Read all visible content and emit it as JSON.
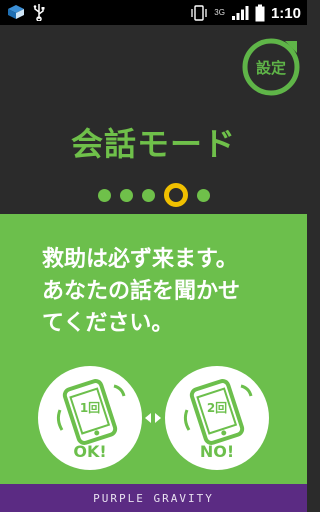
{
  "status_bar": {
    "time": "1:10",
    "network": "3G",
    "icons": [
      "dropbox-icon",
      "usb-icon",
      "vibrate-icon",
      "network-3g-icon",
      "signal-icon",
      "battery-icon"
    ]
  },
  "settings": {
    "label": "設定"
  },
  "title": "会話モード",
  "pager": {
    "count": 5,
    "active_index": 3
  },
  "message": "救助は必ず来ます。\nあなたの話を聞かせ\nてください。",
  "buttons": {
    "ok": {
      "count": "1回",
      "label": "OK!"
    },
    "no": {
      "count": "2回",
      "label": "NO!"
    }
  },
  "footer": {
    "brand": "PURPLE GRAVITY"
  },
  "colors": {
    "green": "#6cbf4c",
    "dark": "#2b2b2b",
    "active_dot": "#f0c000",
    "footer": "#5b2b83"
  }
}
